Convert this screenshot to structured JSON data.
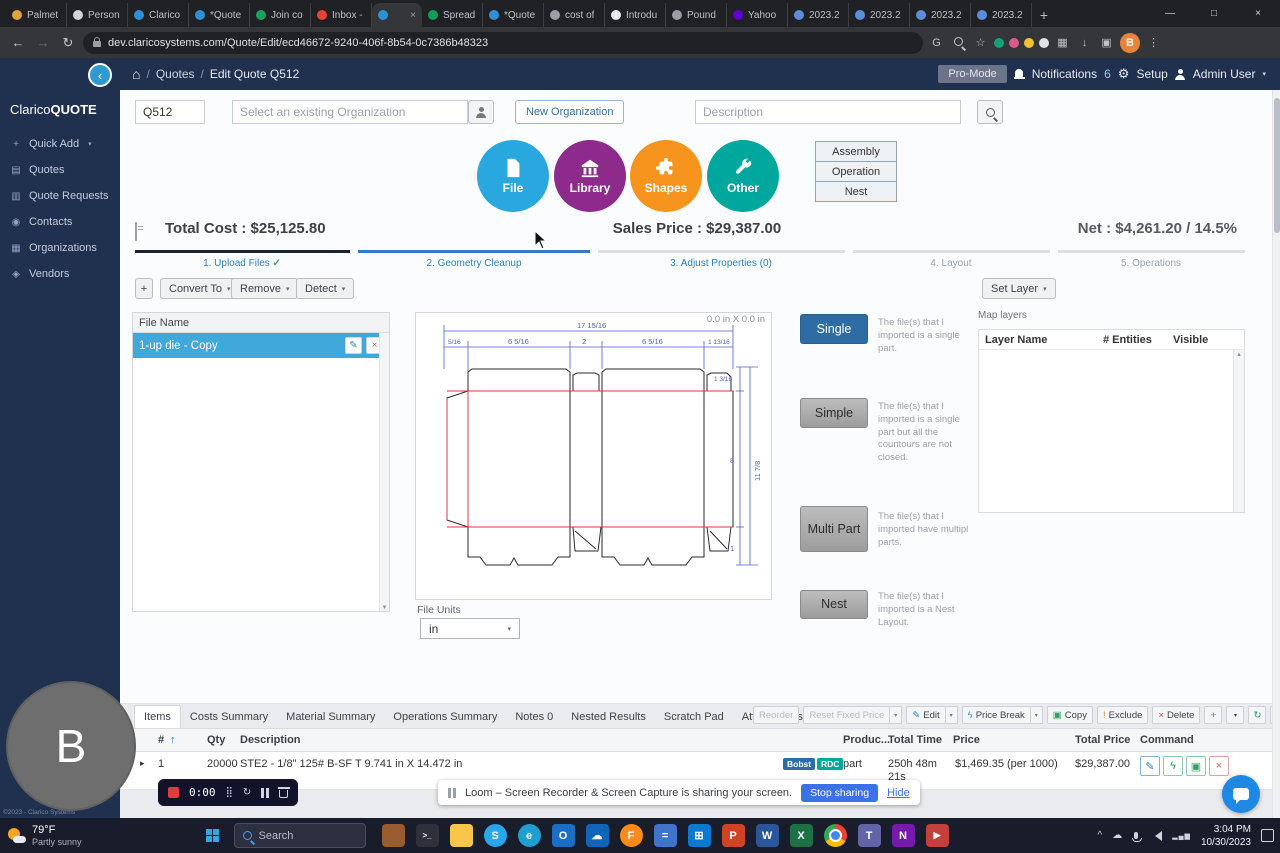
{
  "icons": {
    "caret_down": "▾",
    "check": "✓",
    "plus": "+",
    "close_x": "×",
    "pencil": "✎",
    "lightning": "ϟ",
    "exclaim": "!",
    "refresh": "↻",
    "grid": "▦",
    "sort_up": "↑",
    "expand": "▸",
    "home": "⌂",
    "gear": "⚙",
    "kebab": "⋮",
    "star": "☆",
    "translate": "G",
    "download": "↓",
    "back": "←",
    "forward": "→",
    "panel": "▣",
    "scroll_up": "▲",
    "scroll_down": "▼",
    "drag_grid": "⣿",
    "win_min": "—",
    "win_max": "□",
    "cloud": "☁",
    "net_bars": "▂▄▆",
    "new_tab": "+",
    "play": "▶"
  },
  "browser": {
    "tabs": [
      {
        "label": "Palmet",
        "fav": "#e0a23b"
      },
      {
        "label": "Person",
        "fav": "#cfd2d6"
      },
      {
        "label": "Clarico",
        "fav": "#2e8fd4"
      },
      {
        "label": "*Quote",
        "fav": "#2e8fd4"
      },
      {
        "label": "Join co",
        "fav": "#1aa260"
      },
      {
        "label": "Inbox -",
        "fav": "#ea4335"
      },
      {
        "label": "",
        "fav": "#2e8fd4"
      },
      {
        "label": "Spread",
        "fav": "#0f9d58"
      },
      {
        "label": "*Quote",
        "fav": "#2e8fd4"
      },
      {
        "label": "cost of",
        "fav": "#9aa0a6"
      },
      {
        "label": "Introdu",
        "fav": "#e8eaed"
      },
      {
        "label": "Pound",
        "fav": "#9aa0a6"
      },
      {
        "label": "Yahoo",
        "fav": "#6001d2"
      },
      {
        "label": "2023.2",
        "fav": "#5b8dd9"
      },
      {
        "label": "2023.2",
        "fav": "#5b8dd9"
      },
      {
        "label": "2023.2",
        "fav": "#5b8dd9"
      },
      {
        "label": "2023.2",
        "fav": "#5b8dd9"
      }
    ],
    "url": "dev.claricosystems.com/Quote/Edit/ecd46672-9240-406f-8b54-0c7386b48323",
    "profile_initial": "B",
    "extensions": [
      "#12a07b",
      "#d85b8a",
      "#f1c232",
      "#dfe3e6"
    ]
  },
  "header": {
    "breadcrumb_quotes": "Quotes",
    "breadcrumb_current": "Edit Quote Q512",
    "pro_mode": "Pro-Mode",
    "notifications": "Notifications",
    "notif_count": "6",
    "setup": "Setup",
    "user": "Admin User"
  },
  "sidebar": {
    "logo_a": "Clarico",
    "logo_b": "QUOTE",
    "items": [
      {
        "label": "Quick Add",
        "icon": "+"
      },
      {
        "label": "Quotes",
        "icon": "▤"
      },
      {
        "label": "Quote Requests",
        "icon": "▥"
      },
      {
        "label": "Contacts",
        "icon": "◉"
      },
      {
        "label": "Organizations",
        "icon": "▦"
      },
      {
        "label": "Vendors",
        "icon": "◈"
      }
    ],
    "copyright": "©2023 - Clarico Systems"
  },
  "form": {
    "quote_number": "Q512",
    "org_placeholder": "Select an existing Organization",
    "new_org": "New Organization",
    "description_placeholder": "Description"
  },
  "categories": [
    {
      "label": "File",
      "color": "#29a8e0"
    },
    {
      "label": "Library",
      "color": "#8e2a8b"
    },
    {
      "label": "Shapes",
      "color": "#f7941e"
    },
    {
      "label": "Other",
      "color": "#00a79d"
    }
  ],
  "side_buttons": {
    "assembly": "Assembly",
    "operation": "Operation",
    "nest": "Nest"
  },
  "costs": {
    "total": "Total Cost : $25,125.80",
    "sales": "Sales Price : $29,387.00",
    "net": "Net : $4,261.20 / 14.5%"
  },
  "steps": [
    {
      "label": "1. Upload Files",
      "bar": "#1b2334"
    },
    {
      "label": "2. Geometry Cleanup",
      "bar": "#3579c4"
    },
    {
      "label": "3. Adjust Properties (0)",
      "bar": "#dcdfe4"
    },
    {
      "label": "4. Layout",
      "bar": "#dcdfe4"
    },
    {
      "label": "5. Operations",
      "bar": "#dcdfe4"
    }
  ],
  "toolbar": {
    "convert": "Convert To",
    "remove": "Remove",
    "detect": "Detect",
    "set_layer": "Set Layer"
  },
  "files": {
    "header": "File Name",
    "row1": "1-up die - Copy"
  },
  "preview": {
    "coords": "0.0 in X 0.0 in",
    "file_units_label": "File Units",
    "units_value": "in",
    "dims": {
      "total_w": "17 15/16",
      "glue": "5/16",
      "seg1": "6 5/16",
      "seg2": "2",
      "seg3": "6 5/16",
      "seg4": "1 13/16",
      "total_h": "11 7/8",
      "body_h": "8",
      "top_flap": "1 3/16",
      "bottom_flap": "1"
    }
  },
  "part_options": [
    {
      "label": "Single",
      "desc": "The file(s) that I imported is a single part."
    },
    {
      "label": "Simple",
      "desc": "The file(s) that I imported is a single part but all the countours are not closed."
    },
    {
      "label": "Multi Part",
      "desc": "The file(s) that I imported have multipl parts."
    },
    {
      "label": "Nest",
      "desc": "The file(s) that I imported is a Nest Layout."
    }
  ],
  "map_layers": {
    "title": "Map layers",
    "col_layer": "Layer Name",
    "col_entities": "# Entities",
    "col_visible": "Visible"
  },
  "bottom_tabs": [
    "Items",
    "Costs Summary",
    "Material Summary",
    "Operations Summary",
    "Notes 0",
    "Nested Results",
    "Scratch Pad",
    "Attachments"
  ],
  "items_toolbar": {
    "reorder": "Reorder",
    "reset_fixed_price": "Reset Fixed Price",
    "edit": "Edit",
    "price_break": "Price Break",
    "copy": "Copy",
    "exclude": "Exclude",
    "delete": "Delete"
  },
  "items_table": {
    "col_num": "#",
    "col_qty": "Qty",
    "col_desc": "Description",
    "col_produc": "Produc...",
    "col_total_time": "Total Time",
    "col_price": "Price",
    "col_total_price": "Total Price",
    "col_command": "Command",
    "row": {
      "num": "1",
      "qty": "20000",
      "desc": "STE2 - 1/8\" 125# B-SF T 9.741 in X 14.472 in",
      "badge1": "Bobst",
      "badge2": "RDC",
      "badge1_color": "#2e6da4",
      "badge2_color": "#00a79d",
      "produc": "part",
      "time_line1": "250h 48m",
      "time_line2": "21s",
      "price": "$1,469.35 (per 1000)",
      "total_price": "$29,387.00"
    }
  },
  "loom": {
    "time": "0:00",
    "message": "Loom – Screen Recorder & Screen Capture is sharing your screen.",
    "stop_sharing": "Stop sharing",
    "hide": "Hide",
    "bubble_initial": "B"
  },
  "taskbar": {
    "temp": "79°F",
    "condition": "Partly sunny",
    "search": "Search",
    "clock_time": "3:04 PM",
    "clock_date": "10/30/2023",
    "icons": [
      {
        "glyph": "",
        "color": "#9a5b2e"
      },
      {
        "glyph": ">_",
        "color": "#30303c"
      },
      {
        "glyph": "",
        "color": "#f7c64a"
      },
      {
        "glyph": "S",
        "color": "#28a8ea"
      },
      {
        "glyph": "e",
        "color": "#1e9fd0"
      },
      {
        "glyph": "O",
        "color": "#1a6fc4"
      },
      {
        "glyph": "☁",
        "color": "#0f66b8"
      },
      {
        "glyph": "F",
        "color": "#ff8c1a"
      },
      {
        "glyph": "=",
        "color": "#3f74c9"
      },
      {
        "glyph": "⊞",
        "color": "#0b79d0"
      },
      {
        "glyph": "P",
        "color": "#d04423"
      },
      {
        "glyph": "W",
        "color": "#2b579a"
      },
      {
        "glyph": "X",
        "color": "#1e7145"
      },
      {
        "glyph": "",
        "color": ""
      },
      {
        "glyph": "T",
        "color": "#6264a7"
      },
      {
        "glyph": "N",
        "color": "#7719aa"
      },
      {
        "glyph": "▶",
        "color": "#c2413c"
      }
    ]
  }
}
